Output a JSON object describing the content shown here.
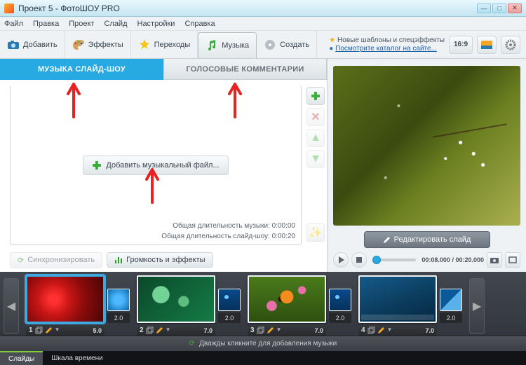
{
  "window": {
    "title": "Проект 5 - ФотоШОУ PRO"
  },
  "menu": [
    "Файл",
    "Правка",
    "Проект",
    "Слайд",
    "Настройки",
    "Справка"
  ],
  "toolbar": {
    "add": "Добавить",
    "effects": "Эффекты",
    "transitions": "Переходы",
    "music": "Музыка",
    "create": "Создать"
  },
  "promo": {
    "line1": "Новые шаблоны и спецэффекты",
    "line2": "Посмотрите каталог на сайте..."
  },
  "aspect": "16:9",
  "musicPanel": {
    "tab_music": "МУЗЫКА СЛАЙД-ШОУ",
    "tab_voice": "ГОЛОСОВЫЕ КОММЕНТАРИИ",
    "add_file": "Добавить музыкальный файл...",
    "dur_music_label": "Общая длительность музыки:",
    "dur_music": "0:00:00",
    "dur_show_label": "Общая длительность слайд-шоу:",
    "dur_show": "0:00:20",
    "sync": "Синхронизировать",
    "volume_fx": "Громкость и эффекты"
  },
  "preview": {
    "edit_slide": "Редактировать слайд",
    "time_current": "00:08.000",
    "time_total": "00:20.000"
  },
  "timeline": {
    "clips": [
      {
        "n": "1",
        "dur": "5.0"
      },
      {
        "n": "2",
        "dur": "7.0"
      },
      {
        "n": "3",
        "dur": "7.0"
      },
      {
        "n": "4",
        "dur": "7.0"
      }
    ],
    "trans_dur": "2.0",
    "hint": "Дважды кликните для добавления музыки",
    "tabs": {
      "slides": "Слайды",
      "scale": "Шкала времени"
    }
  }
}
